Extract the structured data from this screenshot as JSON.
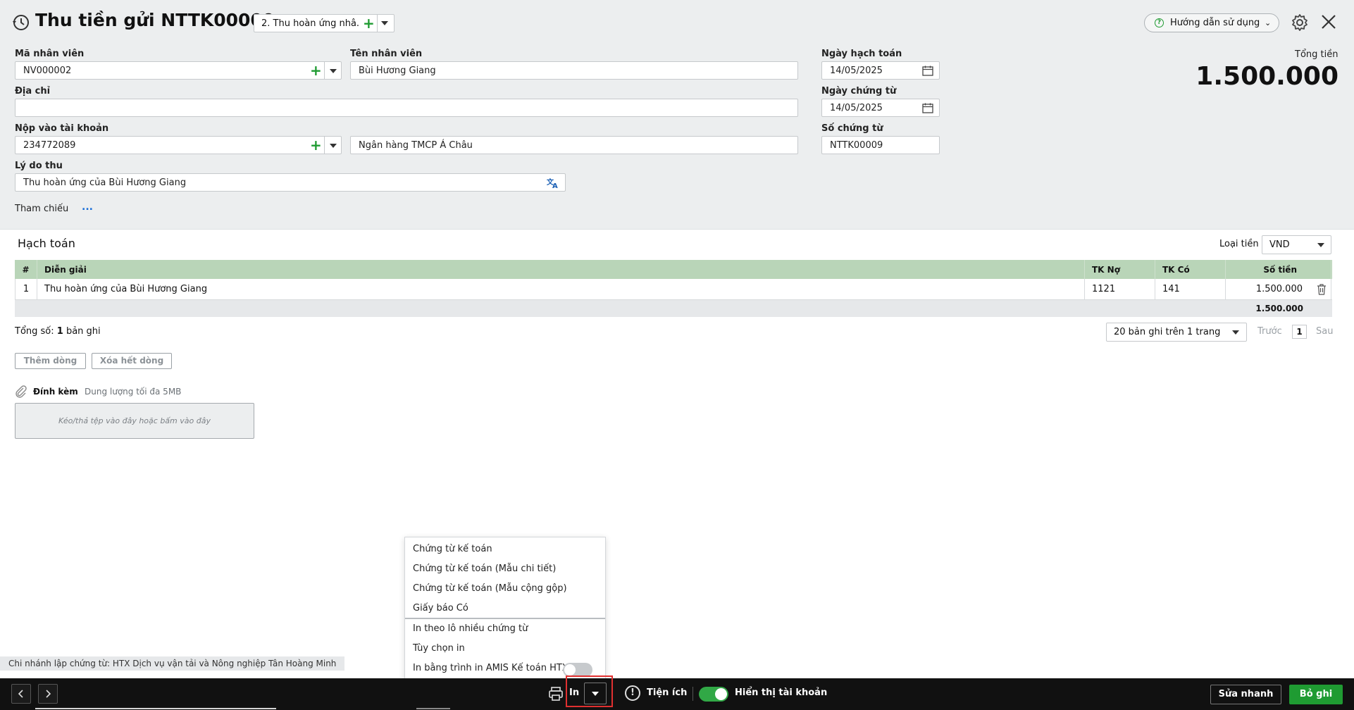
{
  "header": {
    "title": "Thu tiền gửi NTTK00009",
    "voucher_type": "2. Thu hoàn ứng nhâ...",
    "help_label": "Hướng dẫn sử dụng",
    "total_label": "Tổng tiền",
    "total_value": "1.500.000"
  },
  "form": {
    "employee_code_label": "Mã nhân viên",
    "employee_code": "NV000002",
    "employee_name_label": "Tên nhân viên",
    "employee_name": "Bùi Hương Giang",
    "address_label": "Địa chỉ",
    "address": "",
    "deposit_account_label": "Nộp vào tài khoản",
    "deposit_account": "234772089",
    "bank_name": "Ngân hàng TMCP Á Châu",
    "reason_label": "Lý do thu",
    "reason": "Thu hoàn ứng của Bùi Hương Giang",
    "reference_label": "Tham chiếu",
    "reference_more": "...",
    "posting_date_label": "Ngày hạch toán",
    "posting_date": "14/05/2025",
    "voucher_date_label": "Ngày chứng từ",
    "voucher_date": "14/05/2025",
    "voucher_no_label": "Số chứng từ",
    "voucher_no": "NTTK00009"
  },
  "accounting": {
    "title": "Hạch toán",
    "currency_label": "Loại tiền",
    "currency": "VND",
    "columns": [
      "#",
      "Diễn giải",
      "TK Nợ",
      "TK Có",
      "Số tiền"
    ],
    "rows": [
      {
        "no": "1",
        "description": "Thu hoàn ứng của Bùi Hương Giang",
        "debit": "1121",
        "credit": "141",
        "amount": "1.500.000"
      }
    ],
    "footer_total": "1.500.000",
    "count_prefix": "Tổng số:",
    "count_value": "1",
    "count_suffix": "bản ghi",
    "page_size": "20 bản ghi trên 1 trang",
    "prev_label": "Trước",
    "page_number": "1",
    "next_label": "Sau",
    "add_row_label": "Thêm dòng",
    "clear_rows_label": "Xóa hết dòng"
  },
  "attachment": {
    "title": "Đính kèm",
    "note": "Dung lượng tối đa 5MB",
    "drop_text": "Kéo/thả tệp vào đây hoặc bấm vào đây"
  },
  "print_menu": {
    "items_top": [
      "Chứng từ kế toán",
      "Chứng từ kế toán (Mẫu chi tiết)",
      "Chứng từ kế toán (Mẫu cộng gộp)",
      "Giấy báo Có"
    ],
    "items_bottom": [
      "In theo lô nhiều chứng từ",
      "Tùy chọn in",
      "In bằng trình in AMIS Kế toán HTX"
    ],
    "amis_printer_on": false
  },
  "branch_note": "Chi nhánh lập chứng từ: HTX Dịch vụ vận tải và Nông nghiệp Tân Hoàng Minh",
  "bottom_bar": {
    "print_label": "In",
    "utilities_label": "Tiện ích",
    "show_account_label": "Hiển thị tài khoản",
    "show_account_on": true,
    "quick_edit_label": "Sửa nhanh",
    "save_label": "Bỏ ghi"
  },
  "colors": {
    "accent_green": "#1f9b32",
    "grid_header": "#b9d5b8",
    "highlight_red": "#e03030"
  }
}
